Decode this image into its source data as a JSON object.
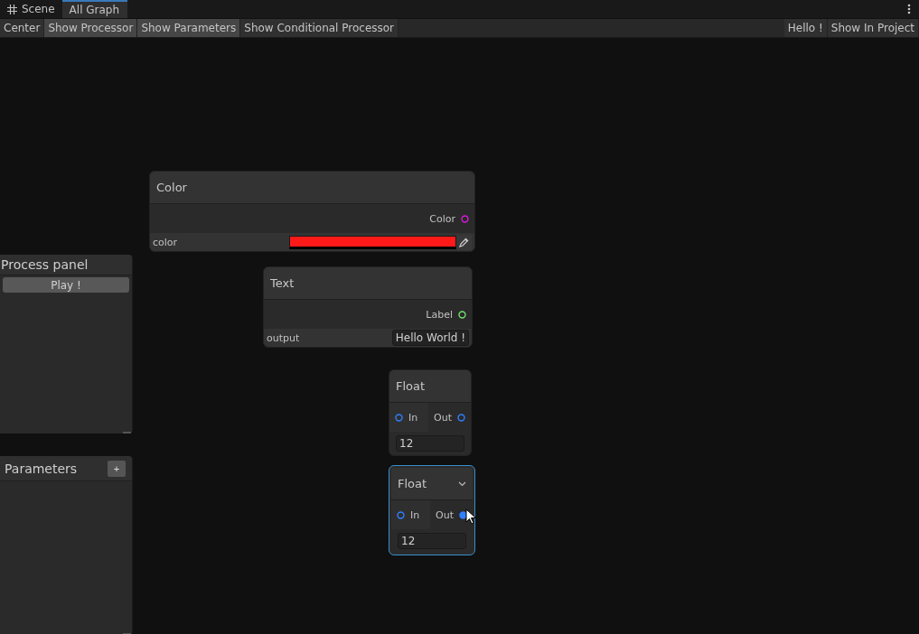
{
  "tabs": [
    {
      "label": "Scene",
      "selected": false
    },
    {
      "label": "All Graph",
      "selected": true
    }
  ],
  "toolbar": {
    "left": [
      {
        "label": "Center",
        "on": false
      },
      {
        "label": "Show Processor",
        "on": true
      },
      {
        "label": "Show Parameters",
        "on": true
      },
      {
        "label": "Show Conditional Processor",
        "on": false
      }
    ],
    "right": [
      {
        "label": "Hello !",
        "on": false
      },
      {
        "label": "Show In Project",
        "on": false
      }
    ]
  },
  "panels": [
    {
      "kind": "process",
      "title": "Process panel",
      "button": "Play !"
    },
    {
      "kind": "parameters",
      "title": "Parameters",
      "button": "+"
    }
  ],
  "nodes": [
    {
      "title": "Color",
      "selected": false,
      "ports": [
        {
          "label": "Color",
          "kind": "output",
          "color": "#d81ad8",
          "filled": false
        }
      ],
      "field": {
        "kind": "color",
        "label": "color",
        "color": "#ff1a1a"
      }
    },
    {
      "title": "Text",
      "selected": false,
      "ports": [
        {
          "label": "Label",
          "kind": "output",
          "color": "#6ee06e",
          "filled": false
        }
      ],
      "field": {
        "kind": "text",
        "label": "output",
        "value": "Hello World !"
      }
    },
    {
      "title": "Float",
      "selected": false,
      "ports": [
        {
          "label": "In",
          "kind": "input",
          "color": "#2f7fff",
          "filled": false
        },
        {
          "label": "Out",
          "kind": "output",
          "color": "#2f7fff",
          "filled": false
        }
      ],
      "field": {
        "kind": "number",
        "value": "12"
      }
    },
    {
      "title": "Float",
      "selected": true,
      "ports": [
        {
          "label": "In",
          "kind": "input",
          "color": "#2f7fff",
          "filled": false
        },
        {
          "label": "Out",
          "kind": "output",
          "color": "#2f7fff",
          "filled": true
        }
      ],
      "field": {
        "kind": "number",
        "value": "12"
      }
    }
  ]
}
